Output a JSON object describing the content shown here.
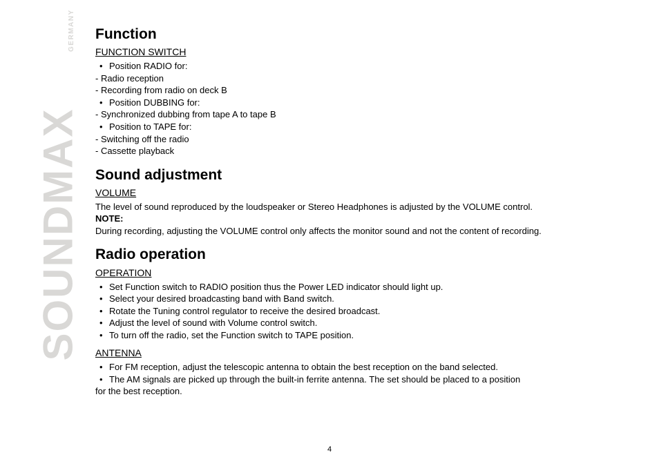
{
  "brand": {
    "name": "SOUNDMAX",
    "sub": "GERMANY"
  },
  "page_number": "4",
  "s1": {
    "title": "Function",
    "sub1": "FUNCTION SWITCH",
    "b1": "Position RADIO for:",
    "d1": "- Radio reception",
    "d2": "- Recording from radio on deck B",
    "b2": "Position DUBBING for:",
    "d3": "- Synchronized dubbing from tape A to tape B",
    "b3": "Position to TAPE for:",
    "d4": "- Switching off the radio",
    "d5": "- Cassette playback"
  },
  "s2": {
    "title": "Sound adjustment",
    "sub1": "VOLUME",
    "p1": "The level of sound reproduced by the loudspeaker or Stereo Headphones is adjusted by the VOLUME control.",
    "note": "NOTE:",
    "p2": "During recording, adjusting the VOLUME control only affects the monitor sound and not the content of recording."
  },
  "s3": {
    "title": "Radio operation",
    "sub1": "OPERATION",
    "b1": "Set Function switch to RADIO position thus the Power LED indicator should light up.",
    "b2": "Select your desired broadcasting band with Band switch.",
    "b3": "Rotate the Tuning control regulator to receive the desired broadcast.",
    "b4": "Adjust the level of sound with Volume control switch.",
    "b5": "To turn off the radio, set the Function switch to TAPE position.",
    "sub2": "ANTENNA",
    "b6": "For FM reception, adjust the telescopic antenna to obtain the best reception on the band selected.",
    "b7": "The AM signals are picked up through the built-in ferrite antenna. The set should be placed to a position",
    "b7tail": "for the best reception."
  }
}
